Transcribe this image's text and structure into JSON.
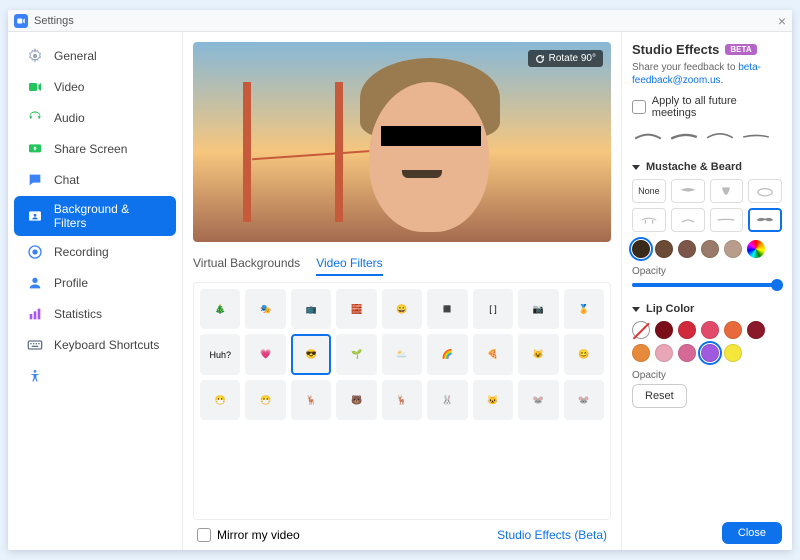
{
  "window": {
    "title": "Settings"
  },
  "sidebar": {
    "items": [
      {
        "label": "General",
        "icon": "gear",
        "color": "#94a3b8"
      },
      {
        "label": "Video",
        "icon": "video",
        "color": "#22c55e"
      },
      {
        "label": "Audio",
        "icon": "audio",
        "color": "#22c55e"
      },
      {
        "label": "Share Screen",
        "icon": "share",
        "color": "#22c55e"
      },
      {
        "label": "Chat",
        "icon": "chat",
        "color": "#3b82f6"
      },
      {
        "label": "Background & Filters",
        "icon": "bg",
        "color": "#ffffff",
        "active": true
      },
      {
        "label": "Recording",
        "icon": "record",
        "color": "#3b82f6"
      },
      {
        "label": "Profile",
        "icon": "profile",
        "color": "#3b82f6"
      },
      {
        "label": "Statistics",
        "icon": "stats",
        "color": "#a855f7"
      },
      {
        "label": "Keyboard Shortcuts",
        "icon": "keyboard",
        "color": "#64748b"
      },
      {
        "label": "Accessibility",
        "icon": "a11y",
        "color": "#3b82f6"
      }
    ]
  },
  "center": {
    "rotate_label": "Rotate 90°",
    "tabs": [
      {
        "label": "Virtual Backgrounds",
        "active": false
      },
      {
        "label": "Video Filters",
        "active": true
      }
    ],
    "filters": {
      "selected_index": 11,
      "items": [
        "🎄",
        "🎭",
        "📺",
        "🧱",
        "😀",
        "◼️",
        "[ ]",
        "📷",
        "🏅",
        "Huh?",
        "💗",
        "😎",
        "🌱",
        "🌥️",
        "🌈",
        "🍕",
        "😺",
        "😊",
        "😷",
        "😷",
        "🦌",
        "🐻",
        "🦌",
        "🐰",
        "🐱",
        "🐭",
        "🐭"
      ]
    },
    "mirror_label": "Mirror my video",
    "studio_link": "Studio Effects (Beta)"
  },
  "right": {
    "title": "Studio Effects",
    "beta": "BETA",
    "feedback_prefix": "Share your feedback to",
    "feedback_email": "beta-feedback@zoom.us",
    "apply_all_label": "Apply to all future meetings",
    "sections": {
      "mustache": {
        "title": "Mustache & Beard",
        "items": [
          "None",
          "",
          "",
          "",
          "",
          "",
          "",
          ""
        ],
        "selected_index": 7,
        "colors": [
          "#3a2a1a",
          "#6b4a36",
          "#7d564a",
          "#9a7a68",
          "#b99d8c",
          "rainbow"
        ],
        "selected_color": 0,
        "opacity_label": "Opacity",
        "opacity_value": 100
      },
      "lip": {
        "title": "Lip Color",
        "colors": [
          "none",
          "#7a0f1a",
          "#d12a3c",
          "#e14a6a",
          "#e86a3c",
          "#8a1a2a",
          "#e88a3c",
          "#e9a6b6",
          "#d66a96",
          "#a05adf",
          "#f5e63c"
        ],
        "selected_color": 9,
        "opacity_label": "Opacity",
        "reset_label": "Reset"
      }
    },
    "close_label": "Close"
  }
}
